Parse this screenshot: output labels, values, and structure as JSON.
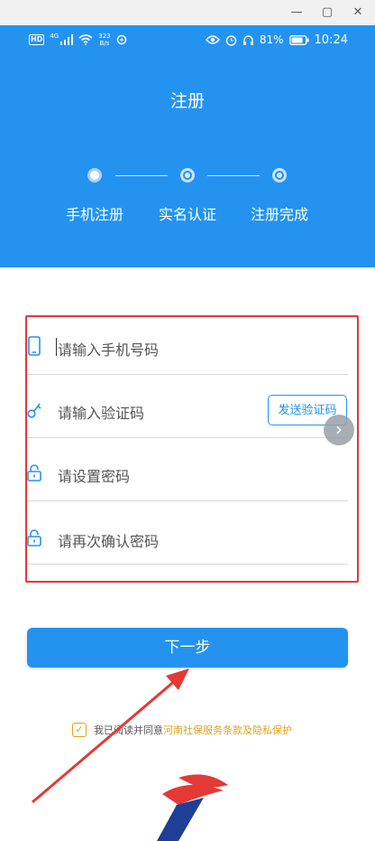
{
  "window": {
    "minimize_glyph": "—",
    "maximize_glyph": "▢",
    "close_glyph": "✕"
  },
  "status_bar": {
    "hd": "HD",
    "network_gen": "4G",
    "speed_value": "323",
    "speed_unit": "B/s",
    "battery": "81%",
    "time": "10:24"
  },
  "header": {
    "title": "注册"
  },
  "steps": [
    {
      "label": "手机注册",
      "active": true
    },
    {
      "label": "实名认证",
      "active": false
    },
    {
      "label": "注册完成",
      "active": false
    }
  ],
  "form": {
    "phone_placeholder": "请输入手机号码",
    "code_placeholder": "请输入验证码",
    "send_code_label": "发送验证码",
    "password_placeholder": "请设置密码",
    "confirm_placeholder": "请再次确认密码"
  },
  "side_arrow": "›",
  "next_button": "下一步",
  "agreement": {
    "checked": true,
    "text": "我已阅读并同意",
    "link": "河南社保服务条款及隐私保护"
  },
  "colors": {
    "brand_blue": "#2493f0",
    "annotation_red": "#e53935",
    "link_orange": "#e0a21c"
  }
}
